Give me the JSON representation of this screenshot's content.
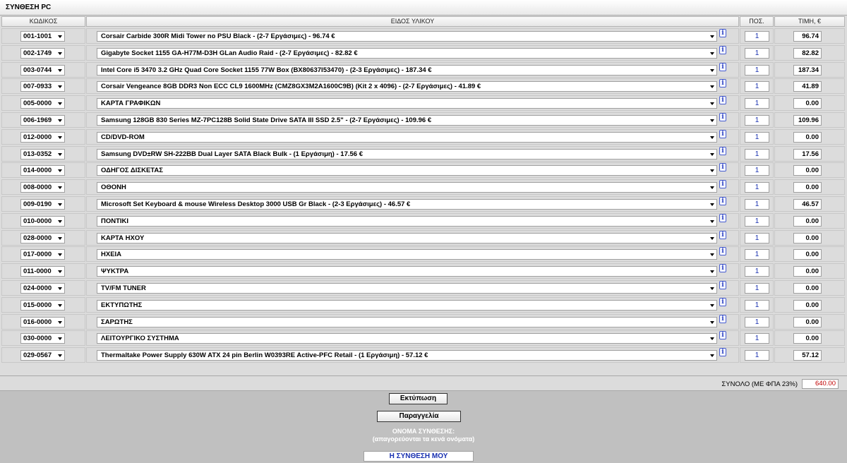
{
  "panel": {
    "title": "ΣΥΝΘΕΣΗ PC"
  },
  "headers": {
    "code": "ΚΩΔΙΚΟΣ",
    "item": "ΕΙΔΟΣ ΥΛΙΚΟΥ",
    "qty": "ΠΟΣ.",
    "price": "ΤΙΜΗ, €"
  },
  "info_label": "i",
  "rows": [
    {
      "code": "001-1001",
      "item": "Corsair Carbide 300R Midi Tower no PSU Black - (2-7 Εργάσιμες) - 96.74 €",
      "qty": "1",
      "price": "96.74"
    },
    {
      "code": "002-1749",
      "item": "Gigabyte Socket 1155 GA-H77M-D3H GLan Audio Raid - (2-7 Εργάσιμες) - 82.82 €",
      "qty": "1",
      "price": "82.82"
    },
    {
      "code": "003-0744",
      "item": "Intel Core i5 3470 3.2 GHz Quad Core Socket 1155 77W Box (BX80637I53470) - (2-3 Εργάσιμες) - 187.34 €",
      "qty": "1",
      "price": "187.34"
    },
    {
      "code": "007-0933",
      "item": "Corsair Vengeance 8GB DDR3 Non ECC CL9 1600MHz (CMZ8GX3M2A1600C9B) (Kit 2 x 4096) - (2-7 Εργάσιμες) - 41.89 €",
      "qty": "1",
      "price": "41.89"
    },
    {
      "code": "005-0000",
      "item": "ΚΑΡΤΑ ΓΡΑΦΙΚΩΝ",
      "qty": "1",
      "price": "0.00"
    },
    {
      "code": "006-1969",
      "item": "Samsung 128GB 830 Series MZ-7PC128B Solid State Drive SATA III SSD 2.5\" - (2-7 Εργάσιμες) - 109.96 €",
      "qty": "1",
      "price": "109.96"
    },
    {
      "code": "012-0000",
      "item": "CD/DVD-ROM",
      "qty": "1",
      "price": "0.00"
    },
    {
      "code": "013-0352",
      "item": "Samsung DVD±RW SH-222BB Dual Layer SATA Black Bulk - (1 Εργάσιμη) - 17.56 €",
      "qty": "1",
      "price": "17.56"
    },
    {
      "code": "014-0000",
      "item": "ΟΔΗΓΟΣ ΔΙΣΚΕΤΑΣ",
      "qty": "1",
      "price": "0.00"
    },
    {
      "code": "008-0000",
      "item": "ΟΘΟΝΗ",
      "qty": "1",
      "price": "0.00"
    },
    {
      "code": "009-0190",
      "item": "Microsoft Set Keyboard & mouse Wireless Desktop 3000 USB Gr Black - (2-3 Εργάσιμες) - 46.57 €",
      "qty": "1",
      "price": "46.57"
    },
    {
      "code": "010-0000",
      "item": "ΠΟΝΤΙΚΙ",
      "qty": "1",
      "price": "0.00"
    },
    {
      "code": "028-0000",
      "item": "ΚΑΡΤΑ ΗΧΟΥ",
      "qty": "1",
      "price": "0.00"
    },
    {
      "code": "017-0000",
      "item": "ΗΧΕΙΑ",
      "qty": "1",
      "price": "0.00"
    },
    {
      "code": "011-0000",
      "item": "ΨΥΚΤΡΑ",
      "qty": "1",
      "price": "0.00"
    },
    {
      "code": "024-0000",
      "item": "TV/FM TUNER",
      "qty": "1",
      "price": "0.00"
    },
    {
      "code": "015-0000",
      "item": "ΕΚΤΥΠΩΤΗΣ",
      "qty": "1",
      "price": "0.00"
    },
    {
      "code": "016-0000",
      "item": "ΣΑΡΩΤΗΣ",
      "qty": "1",
      "price": "0.00"
    },
    {
      "code": "030-0000",
      "item": "ΛΕΙΤΟΥΡΓΙΚΟ ΣΥΣΤΗΜΑ",
      "qty": "1",
      "price": "0.00"
    },
    {
      "code": "029-0567",
      "item": "Thermaltake Power Supply 630W ATX 24 pin Berlin W0393RE Active-PFC Retail - (1 Εργάσιμη) - 57.12 €",
      "qty": "1",
      "price": "57.12"
    }
  ],
  "total": {
    "label": "ΣΥΝΟΛΟ (ΜΕ ΦΠΑ 23%)",
    "value": "640.00"
  },
  "buttons": {
    "print": "Εκτύπωση",
    "order": "Παραγγελία"
  },
  "build_name": {
    "label": "ΟΝΟΜΑ ΣΥΝΘΕΣΗΣ:",
    "note": "(απαγορεύονται τα κενά ονόματα)",
    "value": "Η ΣΥΝΘΕΣΗ ΜΟΥ"
  },
  "colors": {
    "total_value": "#c00000",
    "qty_text": "#1830b0",
    "info_icon": "#2a3fc0"
  }
}
